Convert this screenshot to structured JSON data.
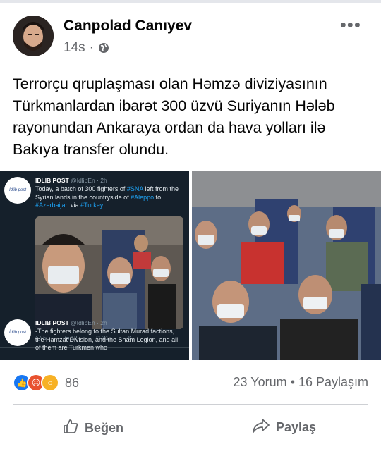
{
  "post": {
    "author": "Canpolad Canıyev",
    "time": "14s",
    "separator": "·",
    "text": "Terrorçu qruplaşması olan Həmzə diviziyasının Türkmanlardan ibarət 300 üzvü Suriyanın Hələb rayonundan Ankaraya ordan da hava yolları ilə Bakıya transfer olundu.",
    "more_label": "•••"
  },
  "tweets": [
    {
      "name": "IDLIB POST",
      "handle": "@IdlibEn · 2h",
      "avatar_text": "İdlib post",
      "text_parts": [
        {
          "t": "Today, a batch of 300 fighters of ",
          "tag": false
        },
        {
          "t": "#SNA",
          "tag": true
        },
        {
          "t": " left from the Syrian lands in the countryside of ",
          "tag": false
        },
        {
          "t": "#Aleppo",
          "tag": true
        },
        {
          "t": " to ",
          "tag": false
        },
        {
          "t": "#Azerbaijan",
          "tag": true
        },
        {
          "t": " via ",
          "tag": false
        },
        {
          "t": "#Turkey",
          "tag": true
        },
        {
          "t": ".",
          "tag": false
        }
      ],
      "actions": [
        "5",
        "12",
        "31",
        ""
      ]
    },
    {
      "name": "IDLIB POST",
      "handle": "@IdlibEn · 2h",
      "avatar_text": "İdlib post",
      "text": "-The fighters belong to the Sultan Murad factions, the Hamzat Division, and the Sham Legion, and all of them are Turkmen who"
    }
  ],
  "engagement": {
    "reaction_count": "86",
    "comments": "23 Yorum",
    "dot": "•",
    "shares": "16 Paylaşım"
  },
  "actions": {
    "like_label": "Beğen",
    "share_label": "Paylaş"
  },
  "colors": {
    "tweet_bg": "#15202b",
    "hashtag": "#1da1f2",
    "like_blue": "#1877f2",
    "meta_gray": "#65676b"
  }
}
